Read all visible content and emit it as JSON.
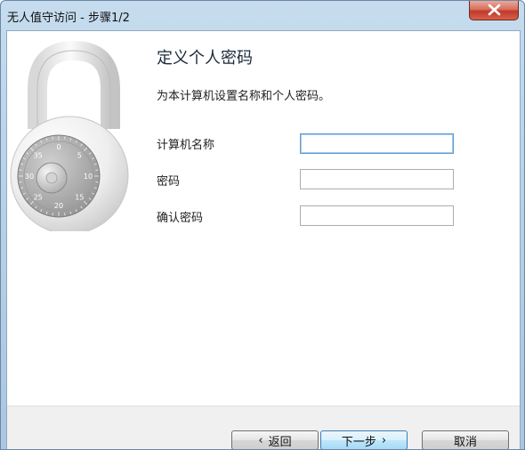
{
  "window": {
    "title": "无人值守访问 - 步骤1/2"
  },
  "page": {
    "heading": "定义个人密码",
    "description": "为本计算机设置名称和个人密码。"
  },
  "form": {
    "computer_name_label": "计算机名称",
    "computer_name_value": "",
    "password_label": "密码",
    "password_value": "",
    "confirm_password_label": "确认密码",
    "confirm_password_value": ""
  },
  "buttons": {
    "back_label": "返回",
    "next_label": "下一步",
    "cancel_label": "取消"
  },
  "lock_dial_numbers": [
    "0",
    "5",
    "10",
    "15",
    "20",
    "25",
    "30",
    "35"
  ],
  "colors": {
    "title_bar": "#b8d2e8",
    "close_button": "#c0392b",
    "default_button_border": "#3c7fb1"
  }
}
